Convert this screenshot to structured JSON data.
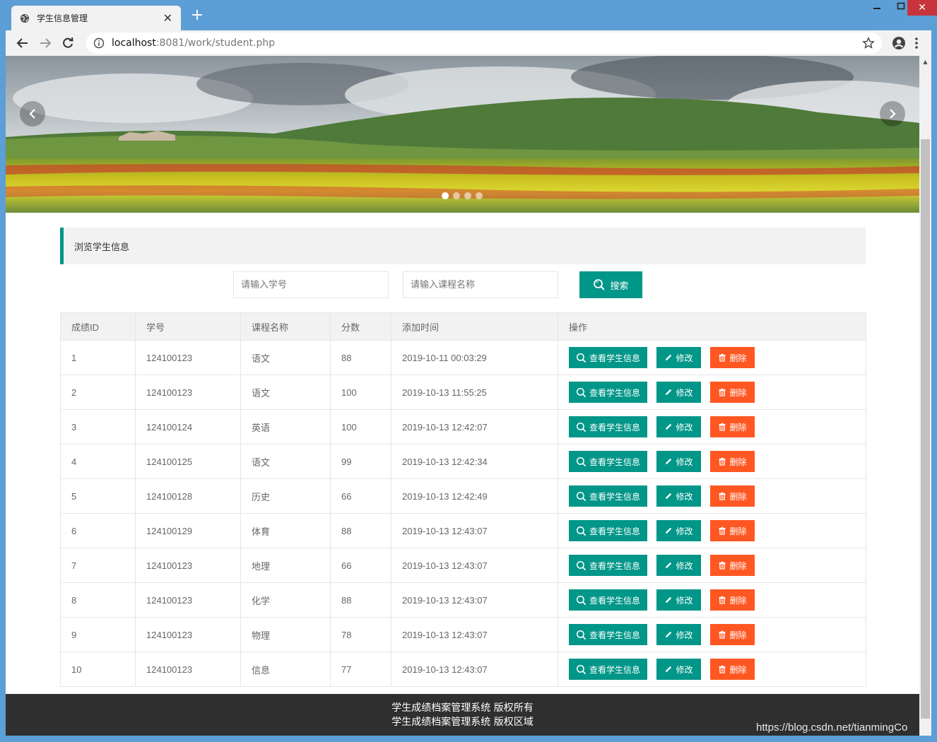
{
  "browser": {
    "tab_title": "学生信息管理",
    "url_host": "localhost",
    "url_path": ":8081/work/student.php"
  },
  "carousel": {
    "slide_count": 4,
    "active_index": 0
  },
  "page": {
    "section_title": "浏览学生信息",
    "search": {
      "student_id_placeholder": "请输入学号",
      "course_placeholder": "请输入课程名称",
      "button_label": "搜索"
    }
  },
  "table": {
    "columns": [
      "成绩ID",
      "学号",
      "课程名称",
      "分数",
      "添加时间",
      "操作"
    ],
    "rows": [
      {
        "id": "1",
        "student_no": "124100123",
        "course": "语文",
        "score": "88",
        "time": "2019-10-11 00:03:29"
      },
      {
        "id": "2",
        "student_no": "124100123",
        "course": "语文",
        "score": "100",
        "time": "2019-10-13 11:55:25"
      },
      {
        "id": "3",
        "student_no": "124100124",
        "course": "英语",
        "score": "100",
        "time": "2019-10-13 12:42:07"
      },
      {
        "id": "4",
        "student_no": "124100125",
        "course": "语文",
        "score": "99",
        "time": "2019-10-13 12:42:34"
      },
      {
        "id": "5",
        "student_no": "124100128",
        "course": "历史",
        "score": "66",
        "time": "2019-10-13 12:42:49"
      },
      {
        "id": "6",
        "student_no": "124100129",
        "course": "体育",
        "score": "88",
        "time": "2019-10-13 12:43:07"
      },
      {
        "id": "7",
        "student_no": "124100123",
        "course": "地理",
        "score": "66",
        "time": "2019-10-13 12:43:07"
      },
      {
        "id": "8",
        "student_no": "124100123",
        "course": "化学",
        "score": "88",
        "time": "2019-10-13 12:43:07"
      },
      {
        "id": "9",
        "student_no": "124100123",
        "course": "物理",
        "score": "78",
        "time": "2019-10-13 12:43:07"
      },
      {
        "id": "10",
        "student_no": "124100123",
        "course": "信息",
        "score": "77",
        "time": "2019-10-13 12:43:07"
      }
    ],
    "actions": {
      "view": "查看学生信息",
      "edit": "修改",
      "delete": "删除"
    }
  },
  "footer": {
    "line1": "学生成绩档案管理系统 版权所有",
    "line2": "学生成绩档案管理系统 版权区域"
  },
  "watermark": "https://blog.csdn.net/tianmingCo",
  "colors": {
    "primary": "#009688",
    "danger": "#ff5722",
    "footer_bg": "#2f2f2f",
    "window_frame": "#5b9fd6"
  }
}
